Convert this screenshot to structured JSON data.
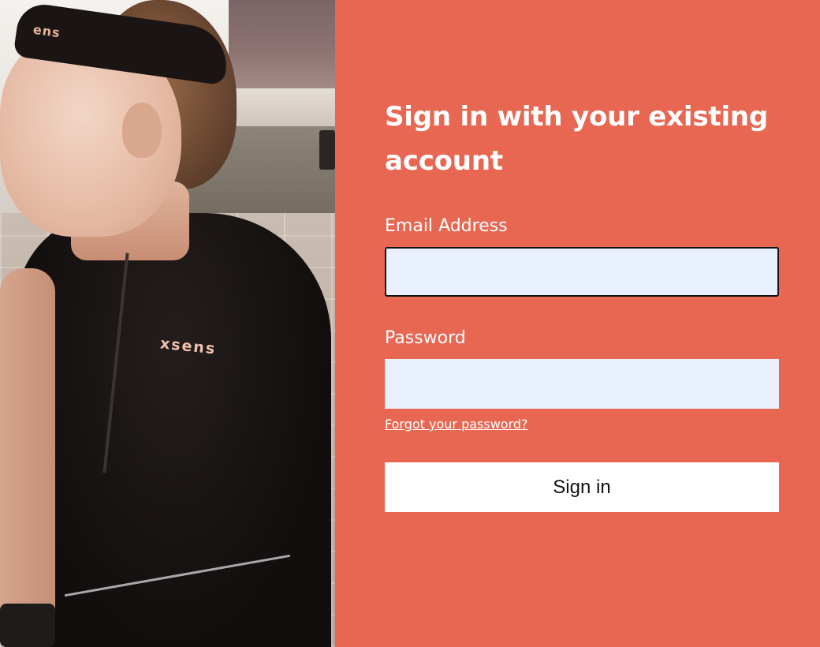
{
  "hero_image": {
    "headband_text": "ens",
    "shirt_logo": "xsens"
  },
  "form": {
    "heading": "Sign in with your existing account",
    "email_label": "Email Address",
    "email_value": "",
    "password_label": "Password",
    "password_value": "",
    "forgot_link": "Forgot your password?",
    "submit_label": "Sign in"
  },
  "colors": {
    "panel_background": "#e86753",
    "input_background": "#e8f0fe",
    "text": "#ffffff",
    "button_background": "#ffffff"
  }
}
